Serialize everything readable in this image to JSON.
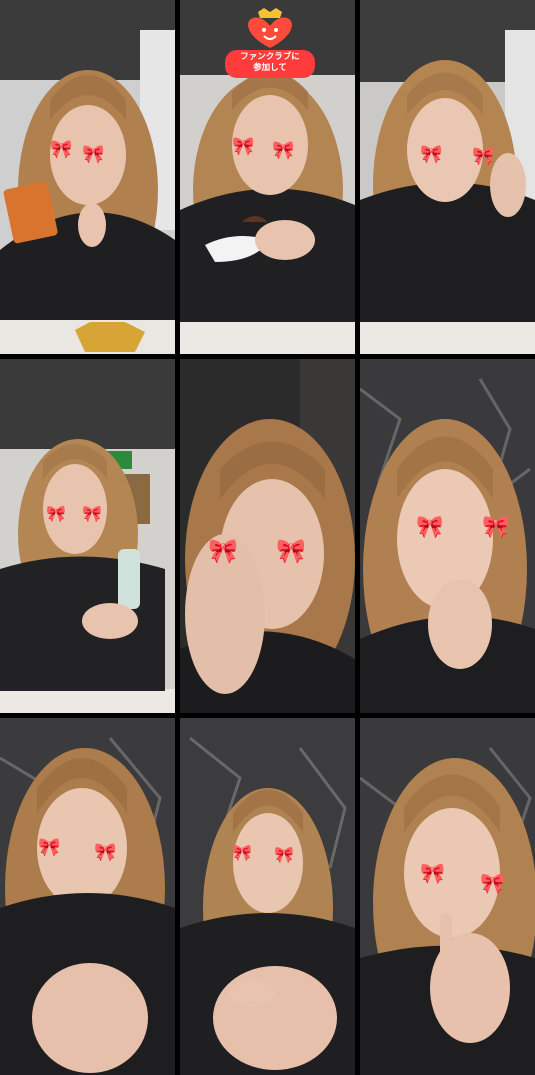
{
  "grid": {
    "rows": 3,
    "cols": 3
  },
  "fanclub_badge": {
    "line1": "ファンクラブに",
    "line2": "参加して"
  },
  "tiles": [
    {
      "name": "tile-r1c1",
      "scene": "room",
      "prop": "orange-box"
    },
    {
      "name": "tile-r1c2",
      "scene": "room",
      "prop": "snack-in-cup"
    },
    {
      "name": "tile-r1c3",
      "scene": "room",
      "prop": "hand-on-cheek"
    },
    {
      "name": "tile-r2c1",
      "scene": "room-exit-sign",
      "prop": "tube"
    },
    {
      "name": "tile-r2c2",
      "scene": "dark-close-up",
      "prop": "hand-at-face"
    },
    {
      "name": "tile-r2c3",
      "scene": "marble-wall",
      "prop": "hand-on-chin"
    },
    {
      "name": "tile-r3c1",
      "scene": "marble-wall",
      "prop": "knee"
    },
    {
      "name": "tile-r3c2",
      "scene": "marble-wall",
      "prop": "knee"
    },
    {
      "name": "tile-r3c3",
      "scene": "marble-wall",
      "prop": "finger-on-lip"
    }
  ],
  "colors": {
    "separator": "#000000",
    "hair": "#b0804f",
    "skin": "#e8c3ae",
    "jacket": "#1f1f22",
    "marble": "#3a3a3c"
  }
}
